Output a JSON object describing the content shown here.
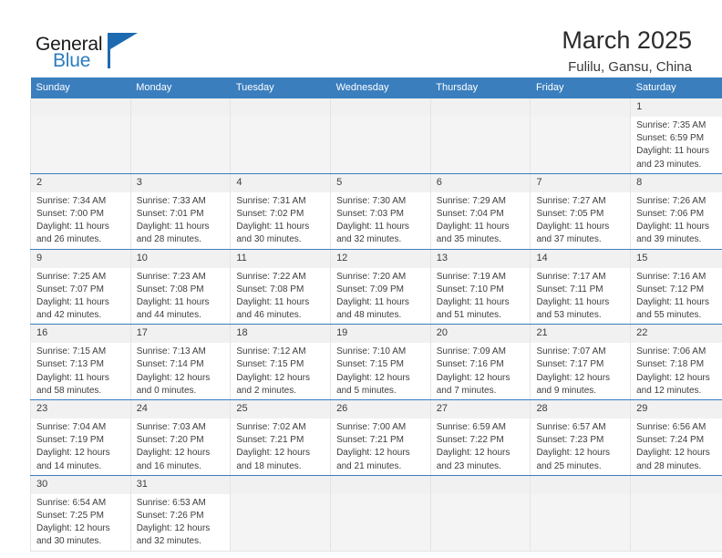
{
  "brand": {
    "name_top": "General",
    "name_bottom": "Blue",
    "accent_color": "#2b7cc0",
    "flag_color": "#1d6ab0"
  },
  "header": {
    "month_title": "March 2025",
    "location": "Fulilu, Gansu, China",
    "header_bg": "#3a7ebe",
    "row_divider_color": "#3a7ebe"
  },
  "weekday_headers": [
    "Sunday",
    "Monday",
    "Tuesday",
    "Wednesday",
    "Thursday",
    "Friday",
    "Saturday"
  ],
  "weeks": [
    [
      {
        "day": "",
        "empty": true
      },
      {
        "day": "",
        "empty": true
      },
      {
        "day": "",
        "empty": true
      },
      {
        "day": "",
        "empty": true
      },
      {
        "day": "",
        "empty": true
      },
      {
        "day": "",
        "empty": true
      },
      {
        "day": "1",
        "sunrise": "Sunrise: 7:35 AM",
        "sunset": "Sunset: 6:59 PM",
        "daylight_line1": "Daylight: 11 hours",
        "daylight_line2": "and 23 minutes."
      }
    ],
    [
      {
        "day": "2",
        "sunrise": "Sunrise: 7:34 AM",
        "sunset": "Sunset: 7:00 PM",
        "daylight_line1": "Daylight: 11 hours",
        "daylight_line2": "and 26 minutes."
      },
      {
        "day": "3",
        "sunrise": "Sunrise: 7:33 AM",
        "sunset": "Sunset: 7:01 PM",
        "daylight_line1": "Daylight: 11 hours",
        "daylight_line2": "and 28 minutes."
      },
      {
        "day": "4",
        "sunrise": "Sunrise: 7:31 AM",
        "sunset": "Sunset: 7:02 PM",
        "daylight_line1": "Daylight: 11 hours",
        "daylight_line2": "and 30 minutes."
      },
      {
        "day": "5",
        "sunrise": "Sunrise: 7:30 AM",
        "sunset": "Sunset: 7:03 PM",
        "daylight_line1": "Daylight: 11 hours",
        "daylight_line2": "and 32 minutes."
      },
      {
        "day": "6",
        "sunrise": "Sunrise: 7:29 AM",
        "sunset": "Sunset: 7:04 PM",
        "daylight_line1": "Daylight: 11 hours",
        "daylight_line2": "and 35 minutes."
      },
      {
        "day": "7",
        "sunrise": "Sunrise: 7:27 AM",
        "sunset": "Sunset: 7:05 PM",
        "daylight_line1": "Daylight: 11 hours",
        "daylight_line2": "and 37 minutes."
      },
      {
        "day": "8",
        "sunrise": "Sunrise: 7:26 AM",
        "sunset": "Sunset: 7:06 PM",
        "daylight_line1": "Daylight: 11 hours",
        "daylight_line2": "and 39 minutes."
      }
    ],
    [
      {
        "day": "9",
        "sunrise": "Sunrise: 7:25 AM",
        "sunset": "Sunset: 7:07 PM",
        "daylight_line1": "Daylight: 11 hours",
        "daylight_line2": "and 42 minutes."
      },
      {
        "day": "10",
        "sunrise": "Sunrise: 7:23 AM",
        "sunset": "Sunset: 7:08 PM",
        "daylight_line1": "Daylight: 11 hours",
        "daylight_line2": "and 44 minutes."
      },
      {
        "day": "11",
        "sunrise": "Sunrise: 7:22 AM",
        "sunset": "Sunset: 7:08 PM",
        "daylight_line1": "Daylight: 11 hours",
        "daylight_line2": "and 46 minutes."
      },
      {
        "day": "12",
        "sunrise": "Sunrise: 7:20 AM",
        "sunset": "Sunset: 7:09 PM",
        "daylight_line1": "Daylight: 11 hours",
        "daylight_line2": "and 48 minutes."
      },
      {
        "day": "13",
        "sunrise": "Sunrise: 7:19 AM",
        "sunset": "Sunset: 7:10 PM",
        "daylight_line1": "Daylight: 11 hours",
        "daylight_line2": "and 51 minutes."
      },
      {
        "day": "14",
        "sunrise": "Sunrise: 7:17 AM",
        "sunset": "Sunset: 7:11 PM",
        "daylight_line1": "Daylight: 11 hours",
        "daylight_line2": "and 53 minutes."
      },
      {
        "day": "15",
        "sunrise": "Sunrise: 7:16 AM",
        "sunset": "Sunset: 7:12 PM",
        "daylight_line1": "Daylight: 11 hours",
        "daylight_line2": "and 55 minutes."
      }
    ],
    [
      {
        "day": "16",
        "sunrise": "Sunrise: 7:15 AM",
        "sunset": "Sunset: 7:13 PM",
        "daylight_line1": "Daylight: 11 hours",
        "daylight_line2": "and 58 minutes."
      },
      {
        "day": "17",
        "sunrise": "Sunrise: 7:13 AM",
        "sunset": "Sunset: 7:14 PM",
        "daylight_line1": "Daylight: 12 hours",
        "daylight_line2": "and 0 minutes."
      },
      {
        "day": "18",
        "sunrise": "Sunrise: 7:12 AM",
        "sunset": "Sunset: 7:15 PM",
        "daylight_line1": "Daylight: 12 hours",
        "daylight_line2": "and 2 minutes."
      },
      {
        "day": "19",
        "sunrise": "Sunrise: 7:10 AM",
        "sunset": "Sunset: 7:15 PM",
        "daylight_line1": "Daylight: 12 hours",
        "daylight_line2": "and 5 minutes."
      },
      {
        "day": "20",
        "sunrise": "Sunrise: 7:09 AM",
        "sunset": "Sunset: 7:16 PM",
        "daylight_line1": "Daylight: 12 hours",
        "daylight_line2": "and 7 minutes."
      },
      {
        "day": "21",
        "sunrise": "Sunrise: 7:07 AM",
        "sunset": "Sunset: 7:17 PM",
        "daylight_line1": "Daylight: 12 hours",
        "daylight_line2": "and 9 minutes."
      },
      {
        "day": "22",
        "sunrise": "Sunrise: 7:06 AM",
        "sunset": "Sunset: 7:18 PM",
        "daylight_line1": "Daylight: 12 hours",
        "daylight_line2": "and 12 minutes."
      }
    ],
    [
      {
        "day": "23",
        "sunrise": "Sunrise: 7:04 AM",
        "sunset": "Sunset: 7:19 PM",
        "daylight_line1": "Daylight: 12 hours",
        "daylight_line2": "and 14 minutes."
      },
      {
        "day": "24",
        "sunrise": "Sunrise: 7:03 AM",
        "sunset": "Sunset: 7:20 PM",
        "daylight_line1": "Daylight: 12 hours",
        "daylight_line2": "and 16 minutes."
      },
      {
        "day": "25",
        "sunrise": "Sunrise: 7:02 AM",
        "sunset": "Sunset: 7:21 PM",
        "daylight_line1": "Daylight: 12 hours",
        "daylight_line2": "and 18 minutes."
      },
      {
        "day": "26",
        "sunrise": "Sunrise: 7:00 AM",
        "sunset": "Sunset: 7:21 PM",
        "daylight_line1": "Daylight: 12 hours",
        "daylight_line2": "and 21 minutes."
      },
      {
        "day": "27",
        "sunrise": "Sunrise: 6:59 AM",
        "sunset": "Sunset: 7:22 PM",
        "daylight_line1": "Daylight: 12 hours",
        "daylight_line2": "and 23 minutes."
      },
      {
        "day": "28",
        "sunrise": "Sunrise: 6:57 AM",
        "sunset": "Sunset: 7:23 PM",
        "daylight_line1": "Daylight: 12 hours",
        "daylight_line2": "and 25 minutes."
      },
      {
        "day": "29",
        "sunrise": "Sunrise: 6:56 AM",
        "sunset": "Sunset: 7:24 PM",
        "daylight_line1": "Daylight: 12 hours",
        "daylight_line2": "and 28 minutes."
      }
    ],
    [
      {
        "day": "30",
        "sunrise": "Sunrise: 6:54 AM",
        "sunset": "Sunset: 7:25 PM",
        "daylight_line1": "Daylight: 12 hours",
        "daylight_line2": "and 30 minutes."
      },
      {
        "day": "31",
        "sunrise": "Sunrise: 6:53 AM",
        "sunset": "Sunset: 7:26 PM",
        "daylight_line1": "Daylight: 12 hours",
        "daylight_line2": "and 32 minutes."
      },
      {
        "day": "",
        "empty": true
      },
      {
        "day": "",
        "empty": true
      },
      {
        "day": "",
        "empty": true
      },
      {
        "day": "",
        "empty": true
      },
      {
        "day": "",
        "empty": true
      }
    ]
  ]
}
